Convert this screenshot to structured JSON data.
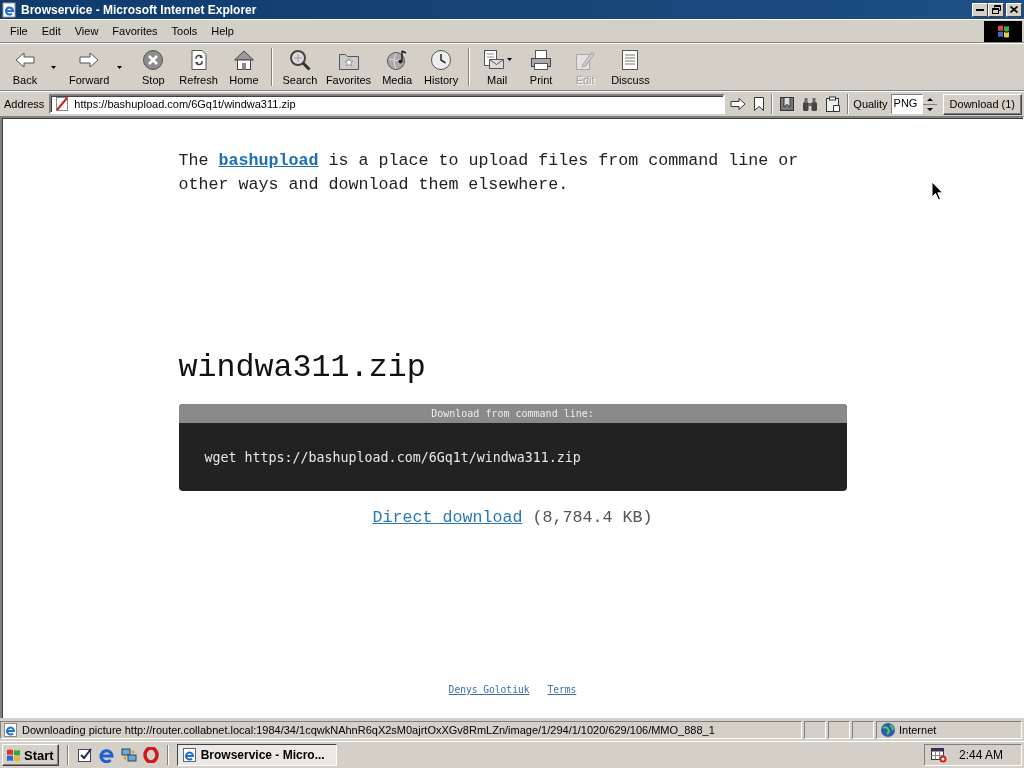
{
  "window": {
    "title": "Browservice - Microsoft Internet Explorer"
  },
  "menu_bar": [
    {
      "label": "File"
    },
    {
      "label": "Edit"
    },
    {
      "label": "View"
    },
    {
      "label": "Favorites"
    },
    {
      "label": "Tools"
    },
    {
      "label": "Help"
    }
  ],
  "toolbar": {
    "groups": [
      {
        "buttons": [
          {
            "label": "Back",
            "kind": "split",
            "disabled": false
          },
          {
            "label": "Forward",
            "kind": "split",
            "disabled": false
          },
          {
            "label": "Stop",
            "kind": "plain",
            "disabled": false
          },
          {
            "label": "Refresh",
            "kind": "plain",
            "disabled": false
          },
          {
            "label": "Home",
            "kind": "plain",
            "disabled": false
          }
        ]
      },
      {
        "buttons": [
          {
            "label": "Search",
            "kind": "plain",
            "disabled": false
          },
          {
            "label": "Favorites",
            "kind": "plain",
            "disabled": false
          },
          {
            "label": "Media",
            "kind": "plain",
            "disabled": false
          },
          {
            "label": "History",
            "kind": "plain",
            "disabled": false
          }
        ]
      },
      {
        "buttons": [
          {
            "label": "Mail",
            "kind": "menu",
            "disabled": false
          },
          {
            "label": "Print",
            "kind": "plain",
            "disabled": false
          },
          {
            "label": "Edit",
            "kind": "plain",
            "disabled": true
          },
          {
            "label": "Discuss",
            "kind": "plain",
            "disabled": false
          }
        ]
      }
    ]
  },
  "address_bar": {
    "label": "Address",
    "url": "https://bashupload.com/6Gq1t/windwa311.zip",
    "quality": {
      "label": "Quality",
      "value": "PNG"
    },
    "download_button": "Download (1)"
  },
  "page": {
    "intro": {
      "before": "The ",
      "link": "bashupload",
      "after": " is a place to upload files from command line or other ways and download them elsewhere."
    },
    "file_name": "windwa311.zip",
    "command_box": {
      "title": "Download from command line:",
      "command": "wget https://bashupload.com/6Gq1t/windwa311.zip"
    },
    "direct_download": {
      "link": "Direct download",
      "size": "(8,784.4 KB)"
    },
    "footer_links": [
      "Denys Golotiuk",
      "Terms"
    ]
  },
  "status_bar": {
    "text": "Downloading picture http://router.collabnet.local:1984/34/1cqwkNAhnR6qX2sM0ajrtOxXGv8RmLZn/image/1/294/1/1020/629/106/MMO_888_1",
    "zone": "Internet"
  },
  "taskbar": {
    "start": "Start",
    "tasks": [
      {
        "label": "Browservice - Micro...",
        "selected": true
      }
    ],
    "clock": "2:44 AM"
  }
}
